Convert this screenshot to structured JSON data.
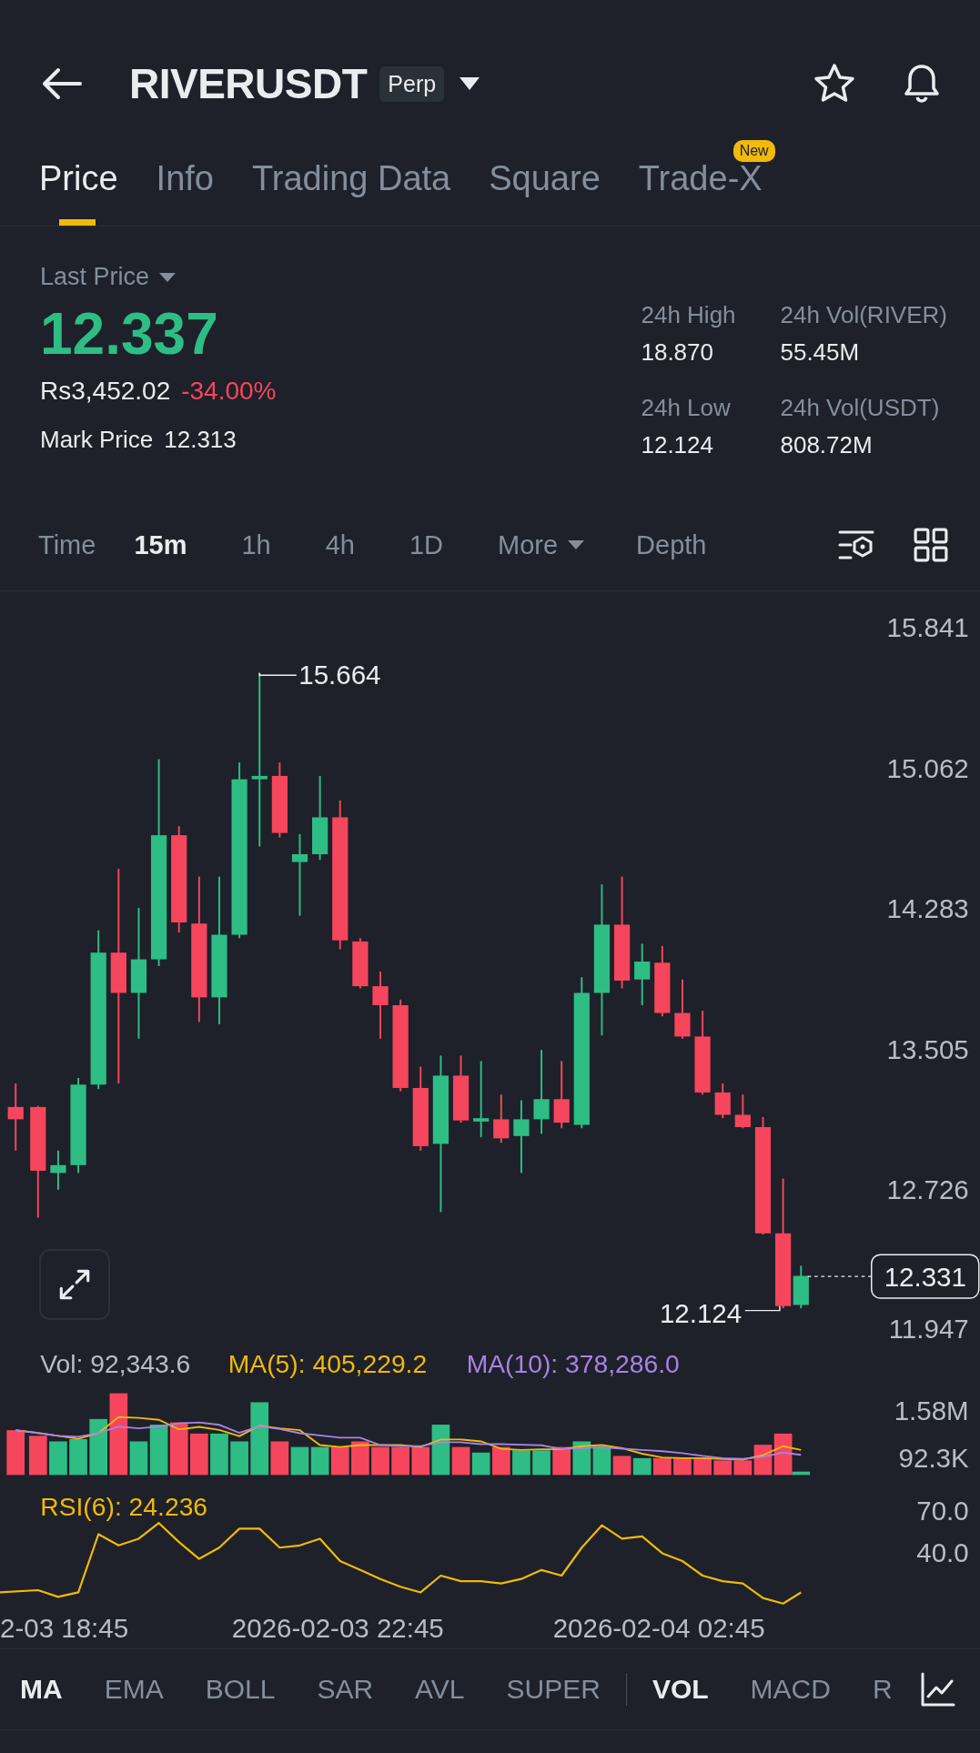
{
  "header": {
    "symbol": "RIVERUSDT",
    "badge": "Perp"
  },
  "tabs": [
    {
      "label": "Price",
      "selected": true
    },
    {
      "label": "Info",
      "selected": false
    },
    {
      "label": "Trading Data",
      "selected": false
    },
    {
      "label": "Square",
      "selected": false
    },
    {
      "label": "Trade-X",
      "selected": false,
      "badge": "New"
    }
  ],
  "summary": {
    "label": "Last Price",
    "price": "12.337",
    "fiat": "Rs3,452.02",
    "change": "-34.00%",
    "mark_label": "Mark Price",
    "mark_price": "12.313",
    "stats": [
      {
        "label": "24h High",
        "value": "18.870"
      },
      {
        "label": "24h Vol(RIVER)",
        "value": "55.45M"
      },
      {
        "label": "24h Low",
        "value": "12.124"
      },
      {
        "label": "24h Vol(USDT)",
        "value": "808.72M"
      }
    ]
  },
  "intervals": [
    {
      "label": "Time",
      "selected": false,
      "kind": "text"
    },
    {
      "label": "15m",
      "selected": true,
      "kind": "text"
    },
    {
      "label": "1h",
      "selected": false,
      "kind": "text"
    },
    {
      "label": "4h",
      "selected": false,
      "kind": "text"
    },
    {
      "label": "1D",
      "selected": false,
      "kind": "text"
    },
    {
      "label": "More",
      "selected": false,
      "kind": "dropdown"
    },
    {
      "label": "Depth",
      "selected": false,
      "kind": "text"
    }
  ],
  "chart": {
    "price_ticks": [
      "15.841",
      "15.062",
      "14.283",
      "13.505",
      "12.726",
      "11.947"
    ],
    "high_label": "15.664",
    "low_label": "12.124",
    "current_price": "12.331",
    "volume_legend": [
      {
        "text": "Vol: 92,343.6",
        "color": "#b7bdc6"
      },
      {
        "text": "MA(5): 405,229.2",
        "color": "#f0b90b"
      },
      {
        "text": "MA(10): 378,286.0",
        "color": "#a882e6"
      }
    ],
    "volume_ticks": [
      "1.58M",
      "92.3K"
    ],
    "rsi_label": "RSI(6): 24.236",
    "rsi_ticks": [
      "70.0",
      "40.0"
    ],
    "time_labels": [
      "2-03 18:45",
      "2026-02-03 22:45",
      "2026-02-04 02:45"
    ]
  },
  "indicators": {
    "main": [
      {
        "label": "MA",
        "selected": true
      },
      {
        "label": "EMA",
        "selected": false
      },
      {
        "label": "BOLL",
        "selected": false
      },
      {
        "label": "SAR",
        "selected": false
      },
      {
        "label": "AVL",
        "selected": false
      },
      {
        "label": "SUPER",
        "selected": false
      }
    ],
    "sub": [
      {
        "label": "VOL",
        "selected": true
      },
      {
        "label": "MACD",
        "selected": false
      },
      {
        "label": "R",
        "selected": false
      }
    ]
  }
}
